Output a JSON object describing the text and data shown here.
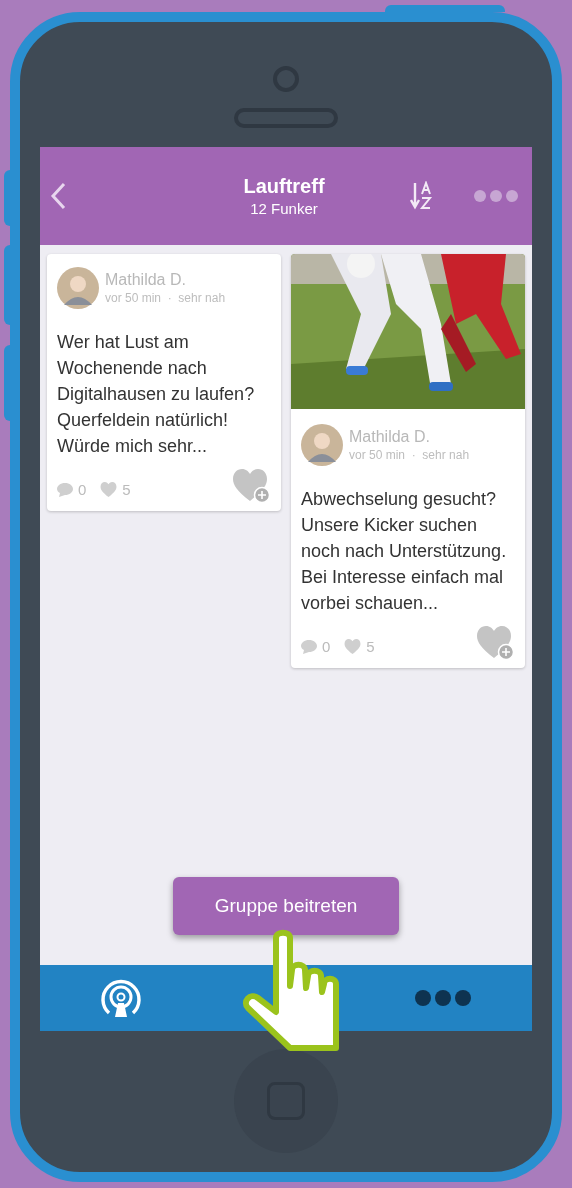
{
  "header": {
    "title": "Lauftreff",
    "subtitle": "12 Funker"
  },
  "columns": [
    [
      {
        "kind": "text",
        "author": "Mathilda D.",
        "meta": "vor 50 min  ·  sehr nah",
        "text": "Wer hat Lust am Wochenende nach Digitalhausen zu laufen? Querfeldein natürlich! Würde mich sehr...",
        "comments": "0",
        "likes": "5"
      }
    ],
    [
      {
        "author": "Mathilda D.",
        "meta": "vor 50 min  ·  sehr nah",
        "text": "Abwechselung gesucht? Unsere Kicker suchen noch nach Unterstützung. Bei Interesse einfach mal vorbei schauen...",
        "comments": "0",
        "likes": "5"
      }
    ]
  ],
  "join_button": "Gruppe beitreten"
}
